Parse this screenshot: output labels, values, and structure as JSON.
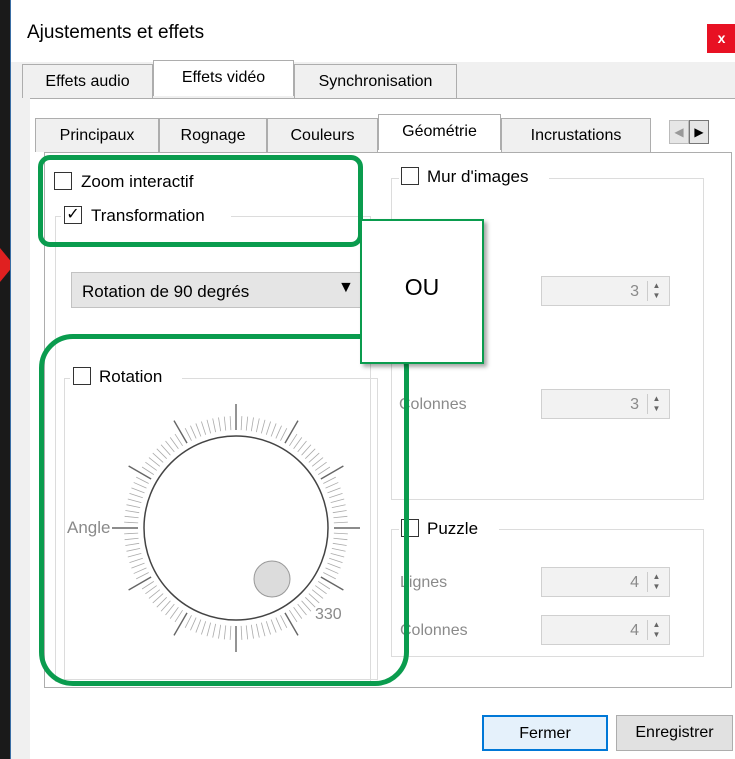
{
  "window": {
    "title": "Ajustements et effets",
    "close_label": "x"
  },
  "top_tabs": [
    "Effets audio",
    "Effets vidéo",
    "Synchronisation"
  ],
  "sub_tabs": [
    "Principaux",
    "Rognage",
    "Couleurs",
    "Géométrie",
    "Incrustations"
  ],
  "sub_tab_scroll": {
    "left": "◀",
    "right": "▶"
  },
  "geometry": {
    "zoom_label": "Zoom interactif",
    "transformation_label": "Transformation",
    "transformation_checked": true,
    "transform_select_value": "Rotation de 90 degrés",
    "rotation_label": "Rotation",
    "angle_label": "Angle",
    "angle_value": "330",
    "wall": {
      "label": "Mur d'images",
      "rows_value": "3",
      "columns_label": "Colonnes",
      "columns_value": "3"
    },
    "puzzle": {
      "label": "Puzzle",
      "rows_label": "Lignes",
      "rows_value": "4",
      "columns_label": "Colonnes",
      "columns_value": "4"
    }
  },
  "annotation": {
    "callout": "OU"
  },
  "buttons": {
    "close": "Fermer",
    "save": "Enregistrer"
  },
  "colors": {
    "annotation_green": "#0a9c4e",
    "close_red": "#e81123",
    "focus_blue": "#0078d7"
  }
}
